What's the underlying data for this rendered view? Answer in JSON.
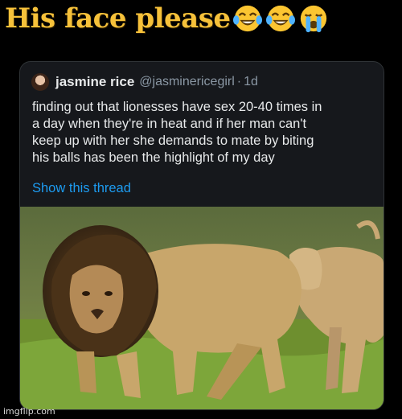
{
  "meme": {
    "caption": "His face please",
    "caption_emojis": [
      "laughing-tears-emoji",
      "laughing-tears-emoji",
      "loudly-crying-emoji"
    ],
    "caption_color": "#f6c13a"
  },
  "tweet": {
    "display_name": "jasmine rice",
    "handle": "@jasminericegirl",
    "separator": "·",
    "time": "1d",
    "text_lines": [
      "finding out that lionesses have sex 20-40 times in",
      "a day when they're in heat and if her man can't",
      "keep up with her she demands to mate by biting",
      "his balls has been the highlight of my day"
    ],
    "show_thread_label": "Show this thread",
    "link_color": "#1d9bf0",
    "photo": "lion-and-lioness-photo"
  },
  "watermark": "imgflip.com"
}
